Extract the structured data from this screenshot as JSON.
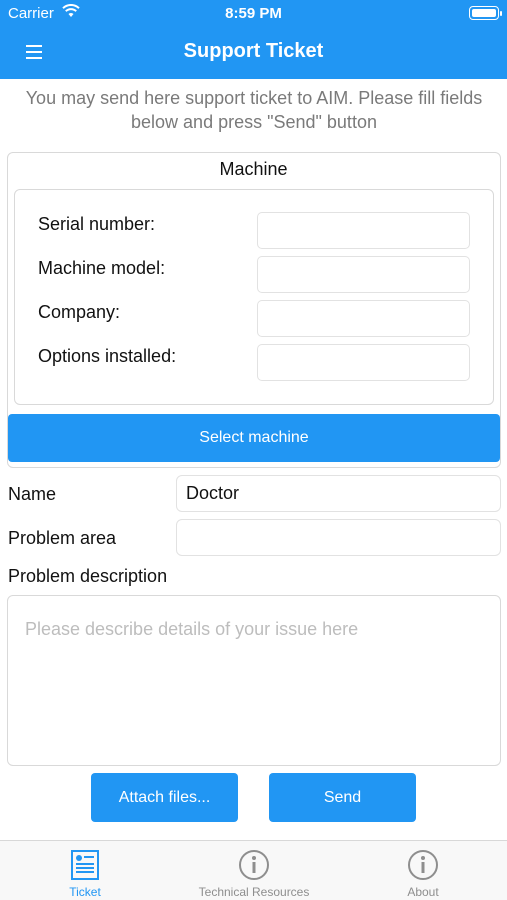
{
  "status_bar": {
    "carrier": "Carrier",
    "time": "8:59 PM"
  },
  "nav": {
    "title": "Support Ticket",
    "menu_icon": "hamburger-menu-icon"
  },
  "intro": {
    "text": "You may send here support ticket to AIM. Please fill fields below and press \"Send\" button"
  },
  "machine": {
    "title": "Machine",
    "fields": [
      {
        "label": "Serial number:",
        "value": ""
      },
      {
        "label": "Machine model:",
        "value": ""
      },
      {
        "label": "Company:",
        "value": ""
      },
      {
        "label": "Options installed:",
        "value": ""
      }
    ],
    "select_button": "Select machine"
  },
  "form": {
    "name_label": "Name",
    "name_value": "Doctor",
    "problem_area_label": "Problem area",
    "problem_area_value": "",
    "description_label": "Problem description",
    "description_placeholder": "Please describe details of your issue here"
  },
  "actions": {
    "attach_label": "Attach files...",
    "send_label": "Send"
  },
  "tabs": [
    {
      "label": "Ticket",
      "icon": "ticket-icon",
      "active": true
    },
    {
      "label": "Technical Resources",
      "icon": "info-icon",
      "active": false
    },
    {
      "label": "About",
      "icon": "info-icon",
      "active": false
    }
  ],
  "colors": {
    "accent": "#2196f3",
    "inactive_tab": "#8e8e8e",
    "placeholder": "#bdbdbd"
  }
}
